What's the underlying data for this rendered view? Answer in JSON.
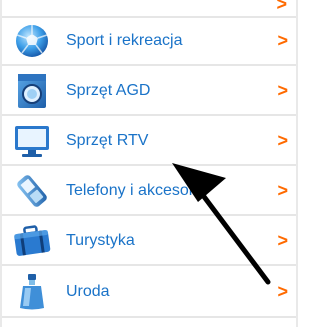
{
  "menu": {
    "items": [
      {
        "label": "Sport i rekreacja",
        "icon": "soccer-ball-icon"
      },
      {
        "label": "Sprzęt AGD",
        "icon": "washing-machine-icon"
      },
      {
        "label": "Sprzęt RTV",
        "icon": "tv-monitor-icon"
      },
      {
        "label": "Telefony i akcesoria",
        "icon": "mobile-phone-icon"
      },
      {
        "label": "Turystyka",
        "icon": "suitcase-icon"
      },
      {
        "label": "Uroda",
        "icon": "perfume-bottle-icon"
      }
    ],
    "chevron": ">"
  },
  "colors": {
    "link": "#1a73c8",
    "chevron": "#ff6a00",
    "divider": "#e6e6e6",
    "arrow": "#000000"
  }
}
